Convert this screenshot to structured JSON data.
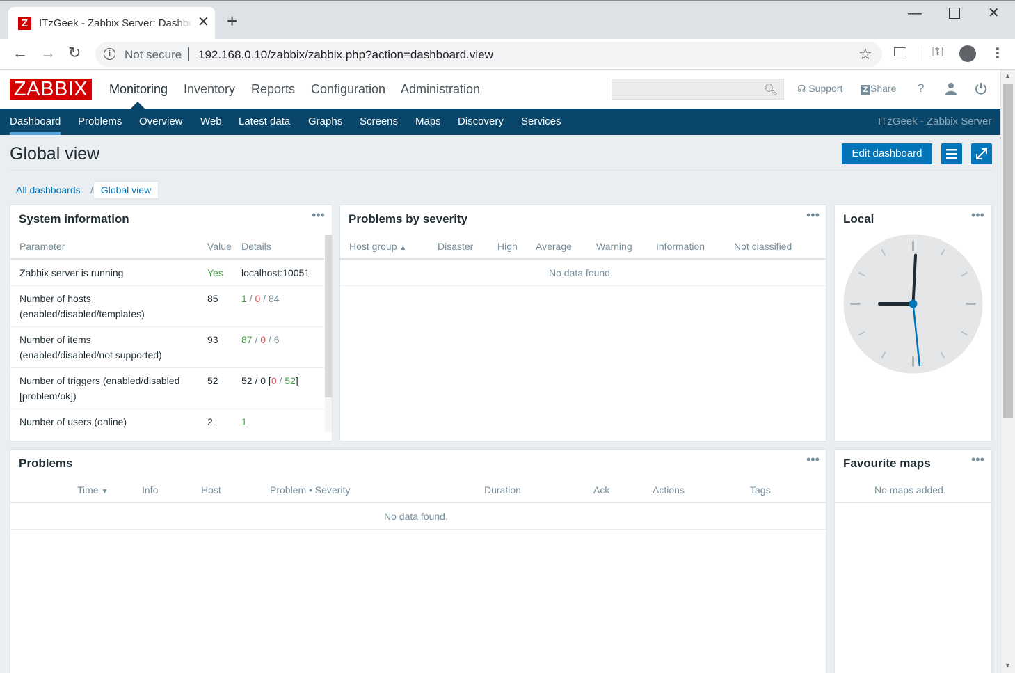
{
  "browser": {
    "tab_title": "ITzGeek - Zabbix Server: Dashboard",
    "favicon_letter": "Z",
    "security": "Not secure",
    "url": "192.168.0.10/zabbix/zabbix.php?action=dashboard.view"
  },
  "header": {
    "logo": "ZABBIX",
    "menu": [
      "Monitoring",
      "Inventory",
      "Reports",
      "Configuration",
      "Administration"
    ],
    "support": "Support",
    "share": "Share",
    "help": "?"
  },
  "subnav": {
    "items": [
      "Dashboard",
      "Problems",
      "Overview",
      "Web",
      "Latest data",
      "Graphs",
      "Screens",
      "Maps",
      "Discovery",
      "Services"
    ],
    "server_name": "ITzGeek - Zabbix Server"
  },
  "page": {
    "title": "Global view",
    "edit_button": "Edit dashboard",
    "breadcrumb_all": "All dashboards",
    "breadcrumb_sep": "/",
    "breadcrumb_current": "Global view"
  },
  "system_info": {
    "title": "System information",
    "headers": [
      "Parameter",
      "Value",
      "Details"
    ],
    "rows": [
      {
        "p1": "Zabbix server is running",
        "p2": "",
        "value": "Yes",
        "d": "localhost:10051"
      },
      {
        "p1": "Number of hosts",
        "p2": "(enabled/disabled/templates)",
        "value": "85",
        "d1": "1",
        "d2": "0",
        "d3": "84"
      },
      {
        "p1": "Number of items",
        "p2": "(enabled/disabled/not supported)",
        "value": "93",
        "d1": "87",
        "d2": "0",
        "d3": "6"
      },
      {
        "p1": "Number of triggers (enabled/disabled",
        "p2": "[problem/ok])",
        "value": "52",
        "d_pre": "52 / 0 [",
        "d1": "0",
        "d2": "52",
        "d_post": "]"
      },
      {
        "p1": "Number of users (online)",
        "p2": "",
        "value": "2",
        "d": "1"
      }
    ]
  },
  "problems_by_severity": {
    "title": "Problems by severity",
    "headers": [
      "Host group",
      "Disaster",
      "High",
      "Average",
      "Warning",
      "Information",
      "Not classified"
    ],
    "empty": "No data found."
  },
  "clock": {
    "title": "Local",
    "hour": 9,
    "minute": 0,
    "second": 29
  },
  "problems": {
    "title": "Problems",
    "headers": [
      "Time",
      "Info",
      "Host",
      "Problem • Severity",
      "Duration",
      "Ack",
      "Actions",
      "Tags"
    ],
    "empty": "No data found."
  },
  "favourite_maps": {
    "title": "Favourite maps",
    "empty": "No maps added."
  },
  "colors": {
    "brand": "#d40000",
    "nav": "#0a466a",
    "button": "#0275b8",
    "ok": "#429e47",
    "problem": "#e45959"
  }
}
